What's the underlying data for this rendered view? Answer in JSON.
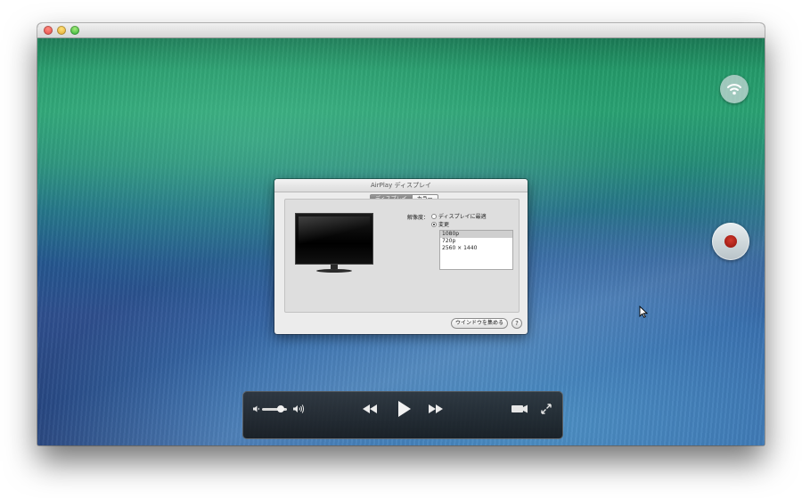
{
  "dialog": {
    "title": "AirPlay ディスプレイ",
    "tabs": [
      {
        "label": "ディスプレイ",
        "active": true
      },
      {
        "label": "カラー",
        "active": false
      }
    ],
    "resolution_label": "解像度：",
    "options": [
      {
        "label": "ディスプレイに最適",
        "checked": false
      },
      {
        "label": "変更",
        "checked": true
      }
    ],
    "resolutions": [
      {
        "label": "1080p",
        "selected": true
      },
      {
        "label": "720p",
        "selected": false
      },
      {
        "label": "2560 × 1440",
        "selected": false
      }
    ],
    "gather_button": "ウインドウを集める",
    "help_button": "?"
  },
  "controls": {
    "volume_level": 0.75,
    "icons": [
      "volume-low-icon",
      "volume-high-icon",
      "rewind-icon",
      "play-icon",
      "fast-forward-icon",
      "airplay-video-icon",
      "fullscreen-icon"
    ]
  },
  "overlay_buttons": {
    "icons": [
      "airplay-wifi-icon",
      "record-icon"
    ],
    "record_color": "#c0271c"
  },
  "window": {
    "traffic_colors": [
      "#e0443e",
      "#dea123",
      "#1aab29"
    ]
  }
}
